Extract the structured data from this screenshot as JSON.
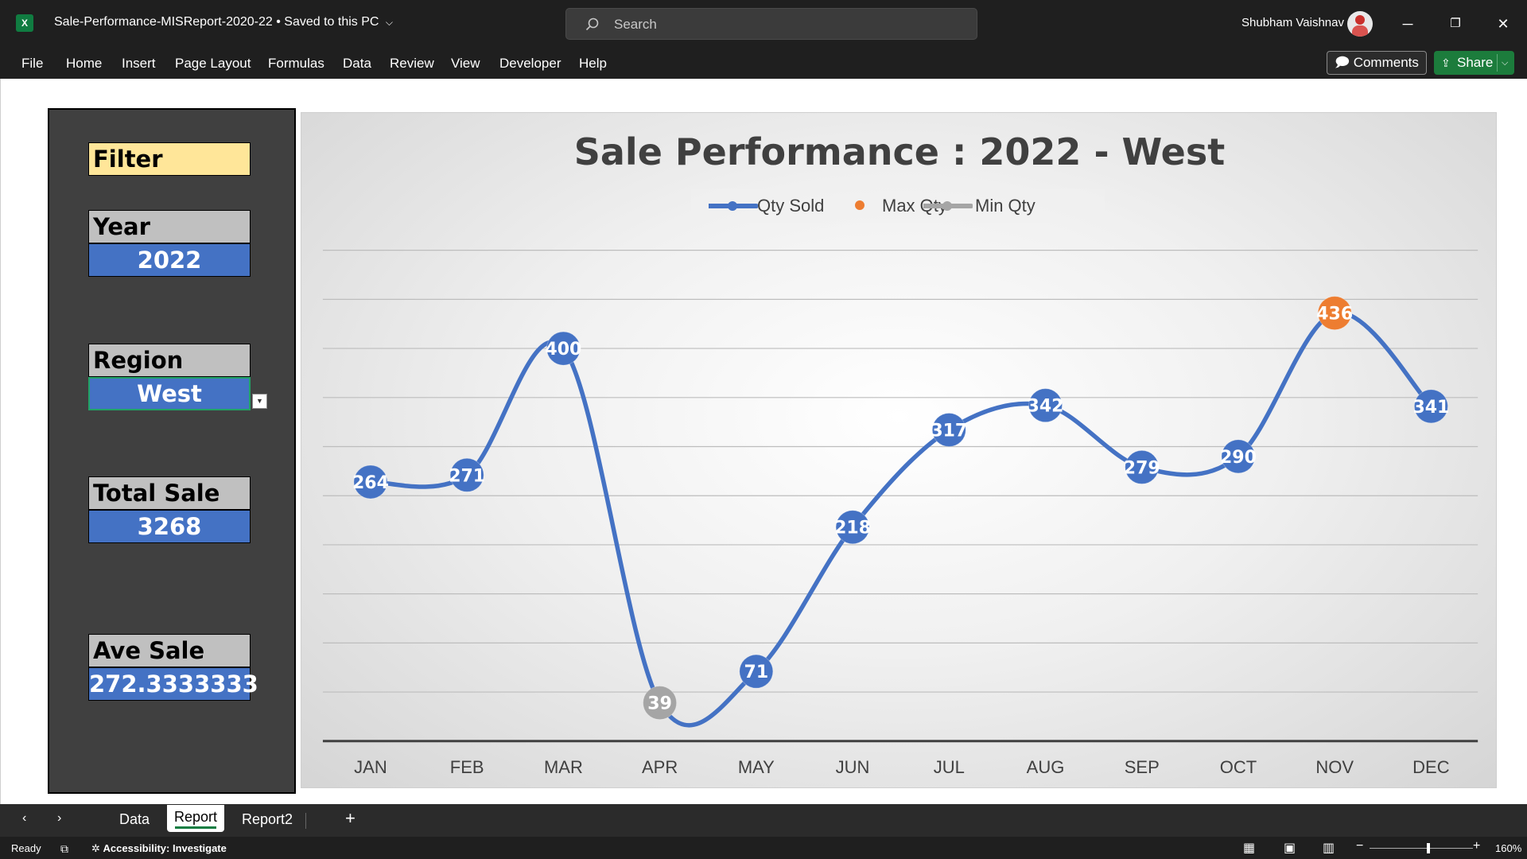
{
  "window": {
    "file_name": "Sale-Performance-MISReport-2020-22",
    "save_status": "Saved to this PC",
    "search_placeholder": "Search",
    "user_name": "Shubham Vaishnav"
  },
  "menu": {
    "items": [
      "File",
      "Home",
      "Insert",
      "Page Layout",
      "Formulas",
      "Data",
      "Review",
      "View",
      "Developer",
      "Help"
    ],
    "comments": "Comments",
    "share": "Share"
  },
  "panel": {
    "filter": "Filter",
    "year_label": "Year",
    "year_value": "2022",
    "region_label": "Region",
    "region_value": "West",
    "total_label": "Total Sale Qty",
    "total_value": "3268",
    "avg_label": "Ave Sale Qty",
    "avg_value": "272.3333333"
  },
  "chart_data": {
    "type": "line",
    "title": "Sale Performance : 2022 - West",
    "categories": [
      "JAN",
      "FEB",
      "MAR",
      "APR",
      "MAY",
      "JUN",
      "JUL",
      "AUG",
      "SEP",
      "OCT",
      "NOV",
      "DEC"
    ],
    "series": [
      {
        "name": "Qty Sold",
        "values": [
          264,
          271,
          400,
          39,
          71,
          218,
          317,
          342,
          279,
          290,
          436,
          341
        ],
        "color": "#4472c4"
      },
      {
        "name": "Max Qty",
        "values": [
          null,
          null,
          null,
          null,
          null,
          null,
          null,
          null,
          null,
          null,
          436,
          null
        ],
        "color": "#ed7d31"
      },
      {
        "name": "Min Qty",
        "values": [
          null,
          null,
          null,
          39,
          null,
          null,
          null,
          null,
          null,
          null,
          null,
          null
        ],
        "color": "#a5a5a5"
      }
    ],
    "ylim": [
      0,
      500
    ],
    "grid": true,
    "legend": "top",
    "smooth": true
  },
  "sheets": {
    "tabs": [
      "Data",
      "Report",
      "Report2"
    ],
    "active": "Report"
  },
  "status": {
    "ready": "Ready",
    "accessibility": "Accessibility: Investigate",
    "zoom": "160%"
  }
}
